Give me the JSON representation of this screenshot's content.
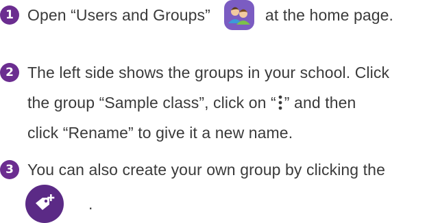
{
  "colors": {
    "step_badge": "#6b2d90",
    "users_icon_bg": "#7b5cc2",
    "tag_button_bg": "#5b2a86"
  },
  "steps": [
    {
      "number": "1",
      "text_before_icon": "Open “Users and Groups”",
      "icon": "users-and-groups-icon",
      "text_after_icon": "at the home page."
    },
    {
      "number": "2",
      "lines": [
        "The left side shows the groups in your school. Click",
        "the group “Sample class”, click on “",
        "” and then",
        "click “Rename” to give it a new name."
      ],
      "icon": "more-vertical-icon"
    },
    {
      "number": "3",
      "text": "You can also create your own group by clicking the",
      "icon": "add-tag-icon",
      "trailing": "."
    }
  ]
}
